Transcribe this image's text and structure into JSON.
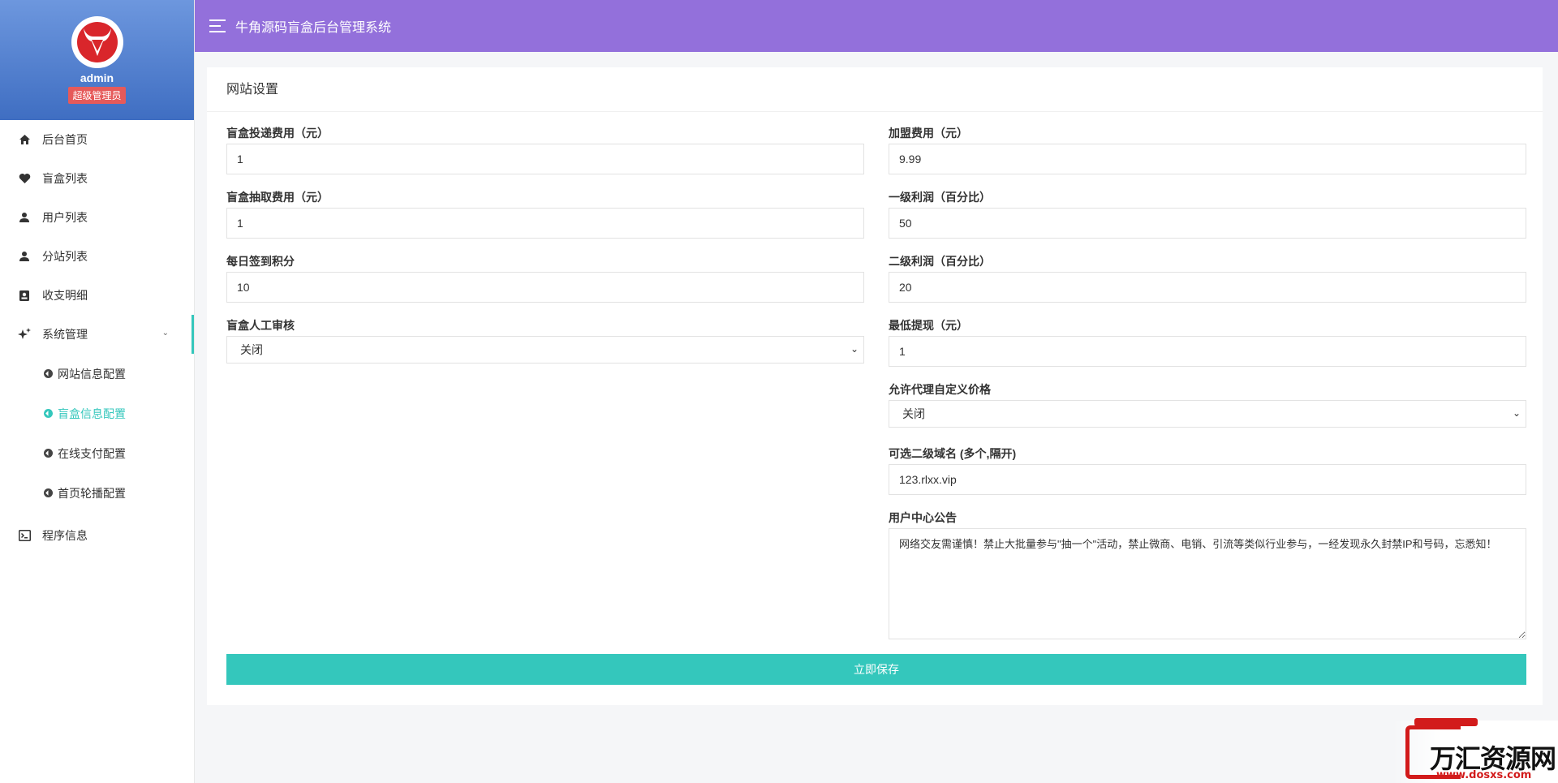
{
  "header": {
    "title": "牛角源码盲盒后台管理系统"
  },
  "profile": {
    "username": "admin",
    "role": "超级管理员"
  },
  "sidebar": {
    "items": [
      {
        "label": "后台首页",
        "icon": "home-icon"
      },
      {
        "label": "盲盒列表",
        "icon": "heart-icon"
      },
      {
        "label": "用户列表",
        "icon": "user-icon"
      },
      {
        "label": "分站列表",
        "icon": "user-icon"
      },
      {
        "label": "收支明细",
        "icon": "contact-card-icon"
      },
      {
        "label": "系统管理",
        "icon": "sparkle-icon",
        "expanded": true
      }
    ],
    "sub_items": [
      {
        "label": "网站信息配置"
      },
      {
        "label": "盲盒信息配置",
        "active": true
      },
      {
        "label": "在线支付配置"
      },
      {
        "label": "首页轮播配置"
      }
    ],
    "last_item": {
      "label": "程序信息",
      "icon": "terminal-icon"
    }
  },
  "card": {
    "title": "网站设置"
  },
  "form": {
    "left": {
      "delivery_fee": {
        "label": "盲盒投递费用（元）",
        "value": "1"
      },
      "draw_fee": {
        "label": "盲盒抽取费用（元）",
        "value": "1"
      },
      "checkin_points": {
        "label": "每日签到积分",
        "value": "10"
      },
      "manual_review": {
        "label": "盲盒人工审核",
        "value": "关闭"
      }
    },
    "right": {
      "franchise_fee": {
        "label": "加盟费用（元）",
        "value": "9.99"
      },
      "level1_profit": {
        "label": "一级利润（百分比）",
        "value": "50"
      },
      "level2_profit": {
        "label": "二级利润（百分比）",
        "value": "20"
      },
      "min_withdraw": {
        "label": "最低提现（元）",
        "value": "1"
      },
      "agent_custom_price": {
        "label": "允许代理自定义价格",
        "value": "关闭"
      },
      "subdomains": {
        "label": "可选二级域名 (多个,隔开)",
        "value": "123.rlxx.vip"
      },
      "notice": {
        "label": "用户中心公告",
        "value": "网络交友需谨慎！禁止大批量参与\"抽一个\"活动，禁止微商、电销、引流等类似行业参与，一经发现永久封禁IP和号码，忘悉知！"
      }
    },
    "save_label": "立即保存"
  },
  "watermark": {
    "name": "万汇资源网",
    "url": "www.dosxs.com"
  },
  "colors": {
    "header": "#9370db",
    "accent": "#34c7bc",
    "profile_bg": "#4f7dcc",
    "badge": "#e65a5a"
  }
}
